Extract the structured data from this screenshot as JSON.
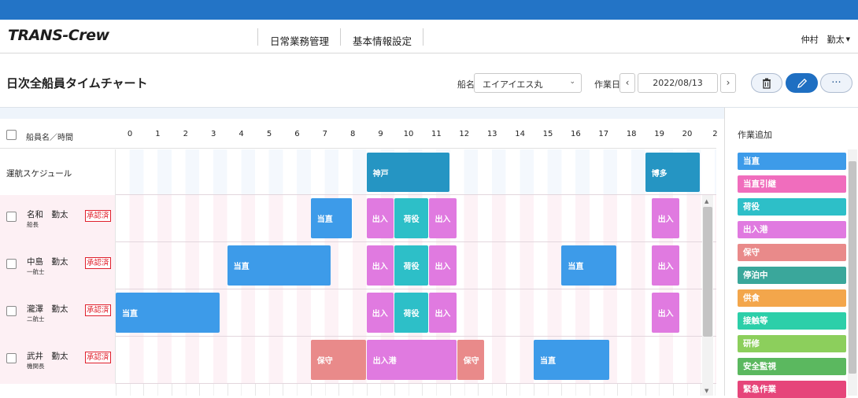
{
  "header": {
    "logo_part1": "TRANS-",
    "logo_part2": "Crew",
    "nav": [
      "日常業務管理",
      "基本情報設定"
    ],
    "user": "仲村　勤太"
  },
  "page": {
    "title": "日次全船員タイムチャート",
    "ship_label": "船名",
    "ship_value": "エイアイエス丸",
    "date_label": "作業日",
    "date_value": "2022/08/13",
    "prev": "‹",
    "next": "›",
    "more": "···"
  },
  "chart": {
    "header_label": "船員名／時間",
    "hours": [
      "0",
      "1",
      "2",
      "3",
      "4",
      "5",
      "6",
      "7",
      "8",
      "9",
      "10",
      "11",
      "12",
      "13",
      "14",
      "15",
      "16",
      "17",
      "18",
      "19",
      "20",
      "2"
    ],
    "schedule_label": "運航スケジュール",
    "schedule": [
      {
        "label": "神戸",
        "start": 9,
        "end": 12,
        "color": "#2595c3"
      },
      {
        "label": "博多",
        "start": 19,
        "end": 21,
        "color": "#2595c3"
      }
    ],
    "crew": [
      {
        "name": "名和　勤太",
        "role": "船長",
        "status": "承認済",
        "tasks": [
          {
            "label": "当直",
            "start": 7,
            "end": 8.5,
            "color": "#3d9be9",
            "center": false
          },
          {
            "label": "出入",
            "start": 9,
            "end": 10,
            "color": "#e07ae0",
            "center": true
          },
          {
            "label": "荷役",
            "start": 10,
            "end": 11.25,
            "color": "#2dbfc8",
            "center": true
          },
          {
            "label": "出入",
            "start": 11.25,
            "end": 12.25,
            "color": "#e07ae0",
            "center": true
          },
          {
            "label": "出入",
            "start": 19.25,
            "end": 20.25,
            "color": "#e07ae0",
            "center": true
          }
        ]
      },
      {
        "name": "中島　勤太",
        "role": "一航士",
        "status": "承認済",
        "tasks": [
          {
            "label": "当直",
            "start": 4,
            "end": 7.75,
            "color": "#3d9be9",
            "center": false
          },
          {
            "label": "出入",
            "start": 9,
            "end": 10,
            "color": "#e07ae0",
            "center": true
          },
          {
            "label": "荷役",
            "start": 10,
            "end": 11.25,
            "color": "#2dbfc8",
            "center": true
          },
          {
            "label": "出入",
            "start": 11.25,
            "end": 12.25,
            "color": "#e07ae0",
            "center": true
          },
          {
            "label": "当直",
            "start": 16,
            "end": 18,
            "color": "#3d9be9",
            "center": false
          },
          {
            "label": "出入",
            "start": 19.25,
            "end": 20.25,
            "color": "#e07ae0",
            "center": true
          }
        ]
      },
      {
        "name": "瀧澤　勤太",
        "role": "二航士",
        "status": "承認済",
        "tasks": [
          {
            "label": "当直",
            "start": 0,
            "end": 3.75,
            "color": "#3d9be9",
            "center": false
          },
          {
            "label": "出入",
            "start": 9,
            "end": 10,
            "color": "#e07ae0",
            "center": true
          },
          {
            "label": "荷役",
            "start": 10,
            "end": 11.25,
            "color": "#2dbfc8",
            "center": true
          },
          {
            "label": "出入",
            "start": 11.25,
            "end": 12.25,
            "color": "#e07ae0",
            "center": true
          },
          {
            "label": "出入",
            "start": 19.25,
            "end": 20.25,
            "color": "#e07ae0",
            "center": true
          }
        ]
      },
      {
        "name": "武井　勤太",
        "role": "機関長",
        "status": "承認済",
        "tasks": [
          {
            "label": "保守",
            "start": 7,
            "end": 9,
            "color": "#e98a8a",
            "center": false
          },
          {
            "label": "出入港",
            "start": 9,
            "end": 12.25,
            "color": "#e07ae0",
            "center": false
          },
          {
            "label": "保守",
            "start": 12.25,
            "end": 13.25,
            "color": "#e98a8a",
            "center": false
          },
          {
            "label": "当直",
            "start": 15,
            "end": 17.75,
            "color": "#3d9be9",
            "center": false
          }
        ]
      }
    ]
  },
  "side": {
    "title": "作業追加",
    "tasks": [
      {
        "label": "当直",
        "color": "#3d9be9"
      },
      {
        "label": "当直引継",
        "color": "#f06dbd"
      },
      {
        "label": "荷役",
        "color": "#2dbfc8"
      },
      {
        "label": "出入港",
        "color": "#e07ae0"
      },
      {
        "label": "保守",
        "color": "#e98a8a"
      },
      {
        "label": "停泊中",
        "color": "#3aa79b"
      },
      {
        "label": "供食",
        "color": "#f3a64b"
      },
      {
        "label": "接触等",
        "color": "#2ccfa9"
      },
      {
        "label": "研修",
        "color": "#8ccf5c"
      },
      {
        "label": "安全監視",
        "color": "#5bb85f"
      },
      {
        "label": "緊急作業",
        "color": "#e6457a"
      }
    ]
  }
}
